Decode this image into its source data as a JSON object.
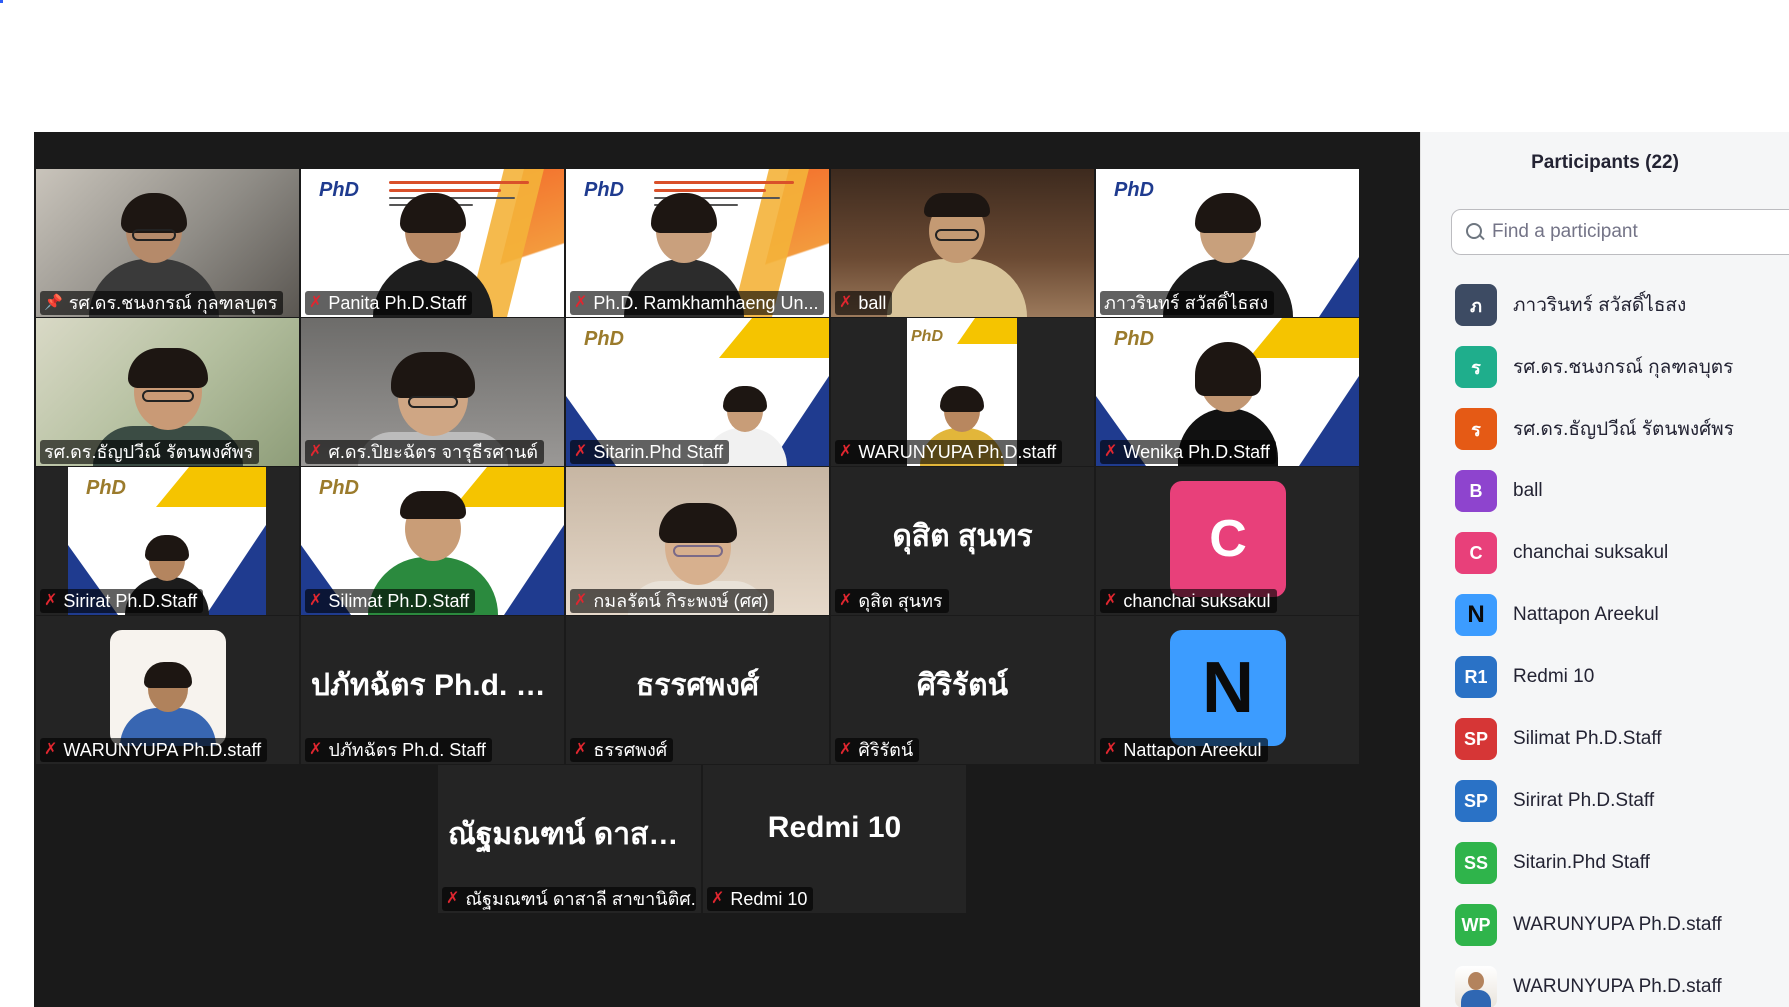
{
  "gallery": {
    "tiles": [
      {
        "name": "รศ.ดร.ชนงกรณ์ กุลฑลบุตร",
        "icon": "pin-icon",
        "muted": false,
        "pinned": true
      },
      {
        "name": "Panita Ph.D.Staff",
        "muted": true
      },
      {
        "name": "Ph.D. Ramkhamhaeng Un...",
        "muted": true
      },
      {
        "name": "ball",
        "muted": true
      },
      {
        "name": "ภาวรินทร์ สวัสดิ์ไธสง",
        "muted": false
      },
      {
        "name": "รศ.ดร.ธัญปวีณ์ รัตนพงศ์พร",
        "muted": false,
        "active": true
      },
      {
        "name": "ศ.ดร.ปิยะฉัตร จารุธีรศานต์",
        "muted": true
      },
      {
        "name": "Sitarin.Phd Staff",
        "muted": true
      },
      {
        "name": "WARUNYUPA Ph.D.staff",
        "muted": true
      },
      {
        "name": "Wenika Ph.D.Staff",
        "muted": true
      },
      {
        "name": "Sirirat Ph.D.Staff",
        "muted": true
      },
      {
        "name": "Silimat Ph.D.Staff",
        "muted": true
      },
      {
        "name": "กมลรัตน์ กิระพงษ์ (ศศ)",
        "muted": true
      },
      {
        "name": "ดุสิต  สุนทร",
        "big": "ดุสิต  สุนทร",
        "muted": true
      },
      {
        "name": "chanchai suksakul",
        "avatar_letter": "C",
        "avatar_color": "#e8407a",
        "muted": true
      },
      {
        "name": "WARUNYUPA Ph.D.staff",
        "muted": true
      },
      {
        "name": "ปภัทฉัตร Ph.d. Staff",
        "big": "ปภัทฉัตร Ph.d. S...",
        "muted": true
      },
      {
        "name": "ธรรศพงศ์",
        "big": "ธรรศพงศ์",
        "muted": true
      },
      {
        "name": "ศิริรัตน์",
        "big": "ศิริรัตน์",
        "muted": true
      },
      {
        "name": "Nattapon Areekul",
        "avatar_letter": "N",
        "avatar_color": "#3c9cff",
        "muted": true
      },
      {
        "name": "ณัฐมณฑน์ ดาสาลี สาขานิติศ...",
        "big": "ณัฐมณฑน์ ดาสาลี...",
        "muted": true
      },
      {
        "name": "Redmi 10",
        "big": "Redmi 10",
        "muted": true
      }
    ],
    "phd_logo": "PhD"
  },
  "participants": {
    "title": "Participants (22)",
    "search_placeholder": "Find a participant",
    "list": [
      {
        "initials": "ภ",
        "color": "#3d4b63",
        "name": "ภาวรินทร์ สวัสดิ์ไธสง"
      },
      {
        "initials": "ร",
        "color": "#1fae8c",
        "name": "รศ.ดร.ชนงกรณ์ กุลฑลบุตร"
      },
      {
        "initials": "ร",
        "color": "#e55a15",
        "name": "รศ.ดร.ธัญปวีณ์ รัตนพงศ์พร"
      },
      {
        "initials": "B",
        "color": "#8e44ce",
        "name": "ball"
      },
      {
        "initials": "C",
        "color": "#e8407a",
        "name": "chanchai suksakul"
      },
      {
        "initials": "N",
        "color": "#3c9cff",
        "name": "Nattapon Areekul"
      },
      {
        "initials": "R1",
        "color": "#2a72c6",
        "name": "Redmi 10"
      },
      {
        "initials": "SP",
        "color": "#d63636",
        "name": "Silimat Ph.D.Staff"
      },
      {
        "initials": "SP",
        "color": "#2a72c6",
        "name": "Sirirat Ph.D.Staff"
      },
      {
        "initials": "SS",
        "color": "#2fb44b",
        "name": "Sitarin.Phd Staff"
      },
      {
        "initials": "WP",
        "color": "#2fb44b",
        "name": "WARUNYUPA Ph.D.staff"
      },
      {
        "initials": "",
        "color": "",
        "name": "WARUNYUPA Ph.D.staff",
        "photo": true
      }
    ]
  }
}
